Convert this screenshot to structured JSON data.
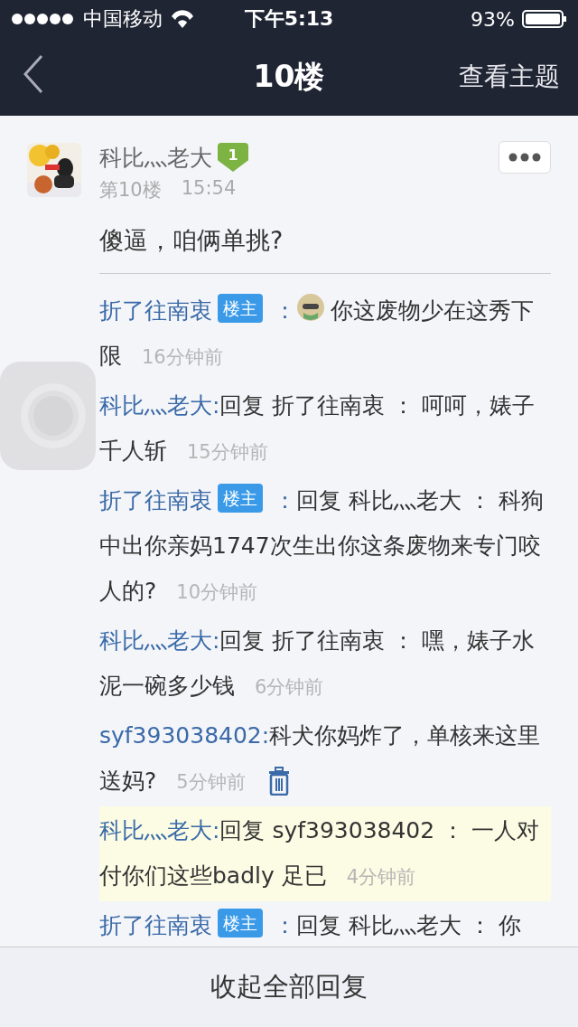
{
  "status_bar": {
    "carrier": "中国移动",
    "time": "下午5:13",
    "battery": "93%"
  },
  "nav": {
    "title": "10楼",
    "action": "查看主题"
  },
  "post": {
    "author": "科比灬老大",
    "level": "1",
    "floor": "第10楼",
    "time": "15:54",
    "body": "傻逼，咱俩单挑?"
  },
  "replies": [
    {
      "author": "折了往南衷",
      "badge": "楼主",
      "colon": "：",
      "emoji": true,
      "text": "你这废物少在这秀下限",
      "time": "16分钟前",
      "deletable": false,
      "highlighted": false
    },
    {
      "author": "科比灬老大",
      "colon": ":",
      "emoji": false,
      "text": "回复 折了往南衷 ： 呵呵，婊子千人斩",
      "time": "15分钟前",
      "deletable": false,
      "highlighted": false
    },
    {
      "author": "折了往南衷",
      "badge": "楼主",
      "colon": "：",
      "emoji": false,
      "text": "回复 科比灬老大 ： 科狗中出你亲妈1747次生出你这条废物来专门咬人的?",
      "time": "10分钟前",
      "deletable": false,
      "highlighted": false
    },
    {
      "author": "科比灬老大",
      "colon": ":",
      "emoji": false,
      "text": "回复 折了往南衷 ： 嘿，婊子水泥一碗多少钱",
      "time": "6分钟前",
      "deletable": false,
      "highlighted": false
    },
    {
      "author": "syf393038402",
      "colon": ":",
      "emoji": false,
      "text": "科犬你妈炸了，单核来这里送妈?",
      "time": "5分钟前",
      "deletable": true,
      "highlighted": false
    },
    {
      "author": "科比灬老大",
      "colon": ":",
      "emoji": false,
      "text": "回复 syf393038402 ： 一人对付你们这些badly 足已",
      "time": "4分钟前",
      "deletable": false,
      "highlighted": true
    },
    {
      "author": "折了往南衷",
      "badge": "楼主",
      "colon": "：",
      "emoji": false,
      "text": "回复 科比灬老大 ： 你",
      "deletable": false,
      "highlighted": false
    }
  ],
  "footer": {
    "button": "收起全部回复"
  }
}
